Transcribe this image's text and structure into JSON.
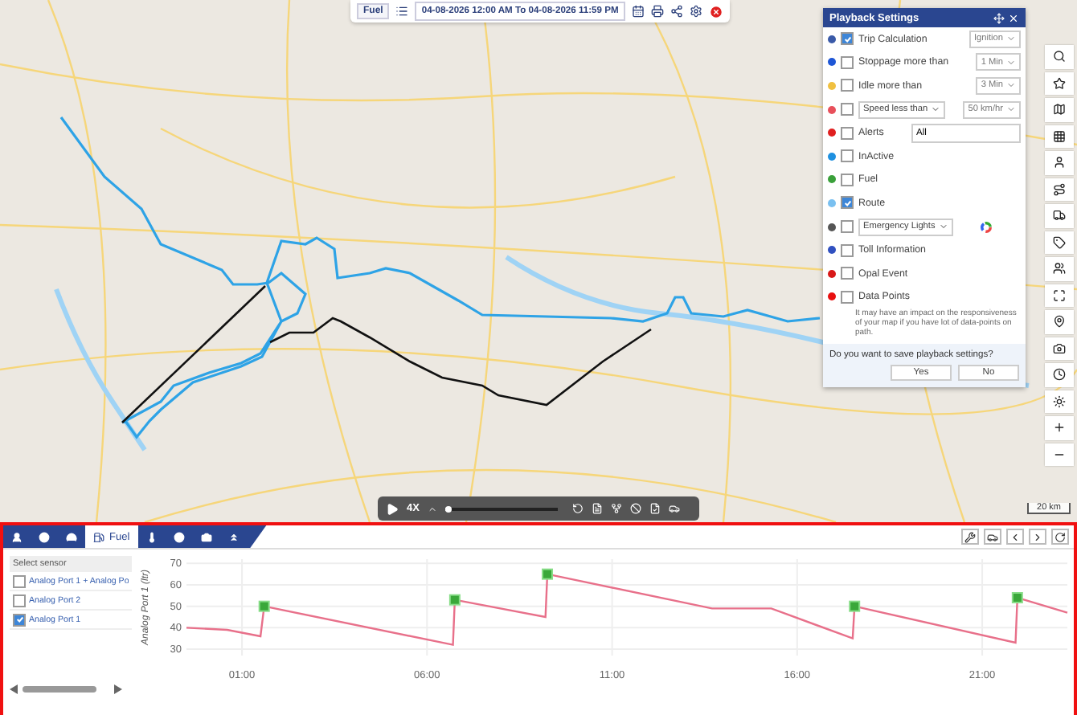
{
  "toolbar": {
    "mode_button": "Fuel",
    "date_range": "04-08-2026 12:00 AM To 04-08-2026 11:59 PM"
  },
  "map": {
    "scale": "20 km"
  },
  "playback_settings": {
    "title": "Playback Settings",
    "rows": [
      {
        "kind": "select",
        "label": "Trip Calculation",
        "checked": true,
        "select": "Ignition",
        "color": "#3a5aa8"
      },
      {
        "kind": "select",
        "label": "Stoppage more than",
        "checked": false,
        "select": "1 Min",
        "color": "#1e56d6"
      },
      {
        "kind": "select",
        "label": "Idle more than",
        "checked": false,
        "select": "3 Min",
        "color": "#f0c040"
      },
      {
        "kind": "dropdown",
        "label": "Speed less than",
        "checked": false,
        "select": "50 km/hr",
        "color": "#e8505b"
      },
      {
        "kind": "field",
        "label": "Alerts",
        "checked": false,
        "value": "All",
        "color": "#e02020"
      },
      {
        "kind": "plain",
        "label": "InActive",
        "checked": false,
        "color": "#1e90e0"
      },
      {
        "kind": "plain",
        "label": "Fuel",
        "checked": false,
        "color": "#3aa03a"
      },
      {
        "kind": "plain",
        "label": "Route",
        "checked": true,
        "color": "#7ac0f0"
      },
      {
        "kind": "wheel",
        "label": "Emergency Lights",
        "checked": false,
        "color": "#555555"
      },
      {
        "kind": "plain",
        "label": "Toll Information",
        "checked": false,
        "color": "#3050c0"
      },
      {
        "kind": "plain",
        "label": "Opal Event",
        "checked": false,
        "color": "#d81818"
      },
      {
        "kind": "plain",
        "label": "Data Points",
        "checked": false,
        "color": "#e81010"
      }
    ],
    "note": "It may have an impact on the responsiveness of your map if you have lot of data-points on path.",
    "save_prompt": "Do you want to save playback settings?",
    "buttons": [
      "Yes",
      "No"
    ]
  },
  "playback_bar": {
    "speed": "4X",
    "level": 0.03
  },
  "bottom_panel": {
    "tabs": [
      {
        "selected": false
      },
      {
        "selected": false
      },
      {
        "selected": false
      },
      {
        "label": "Fuel",
        "selected": true
      },
      {
        "selected": false
      },
      {
        "selected": false
      },
      {
        "selected": false
      },
      {
        "selected": false
      }
    ],
    "sensor_list": {
      "header": "Select sensor",
      "items": [
        {
          "label": "Analog Port 1 + Analog Po",
          "checked": false
        },
        {
          "label": "Analog Port 2",
          "checked": false
        },
        {
          "label": "Analog Port 1",
          "checked": true
        }
      ]
    },
    "chart_data": {
      "type": "line",
      "ylabel": "Analog Port 1 (ltr)",
      "xlim": [
        -0.5,
        23.3
      ],
      "ylim": [
        27,
        72
      ],
      "yticks": [
        30,
        40,
        50,
        60,
        70
      ],
      "xticks": [
        {
          "value": 1,
          "label": "01:00"
        },
        {
          "value": 6,
          "label": "06:00"
        },
        {
          "value": 11,
          "label": "11:00"
        },
        {
          "value": 16,
          "label": "16:00"
        },
        {
          "value": 21,
          "label": "21:00"
        }
      ],
      "x": [
        -0.5,
        0.6,
        1.5,
        1.6,
        6.7,
        6.75,
        9.2,
        9.25,
        13.7,
        15.3,
        17.5,
        17.55,
        21.9,
        21.95,
        23.3
      ],
      "values": [
        40,
        39,
        36,
        50,
        32,
        53,
        45,
        65,
        49,
        49,
        35,
        50,
        33,
        54,
        47
      ],
      "grid": true
    }
  }
}
